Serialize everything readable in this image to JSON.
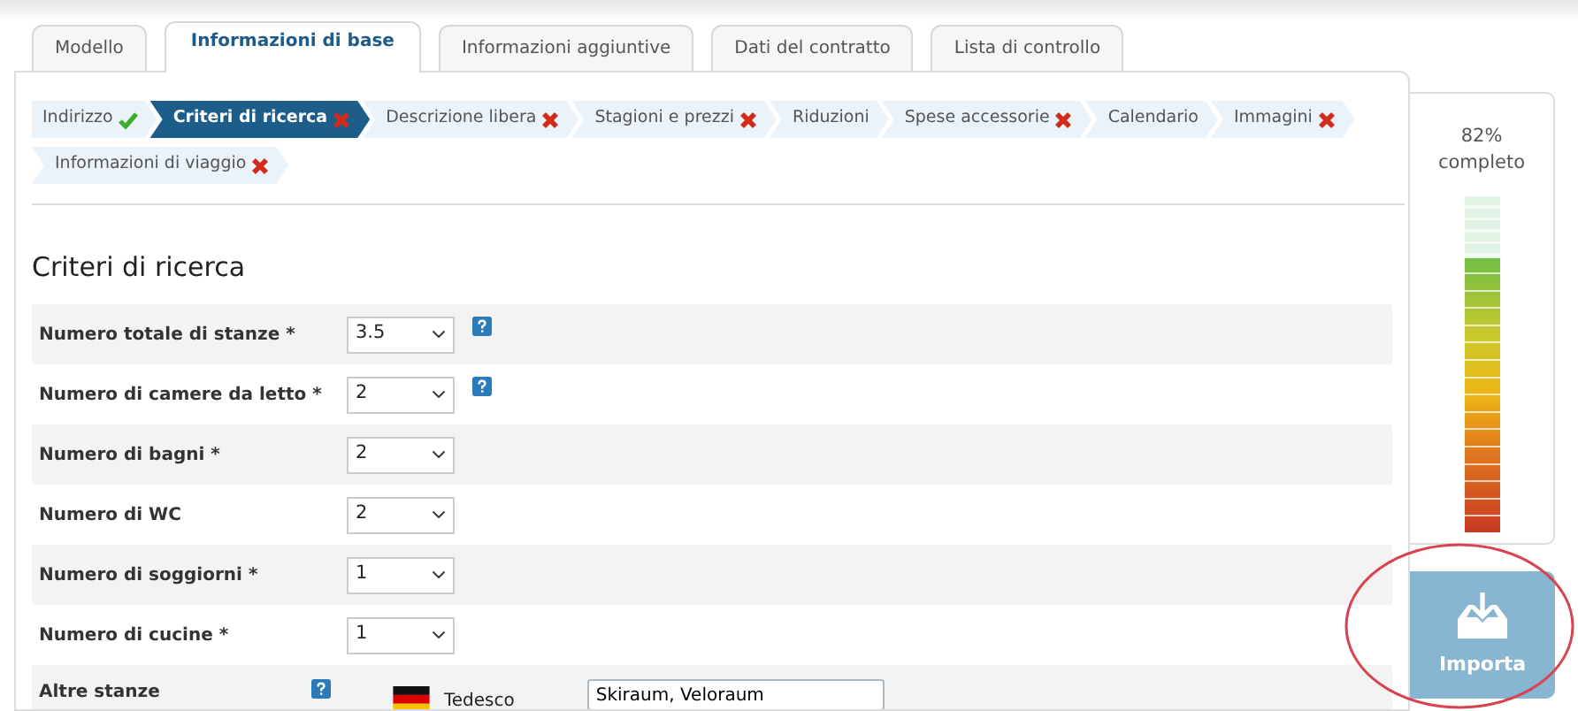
{
  "tabs": [
    {
      "label": "Modello",
      "selected": false
    },
    {
      "label": "Informazioni di base",
      "selected": true
    },
    {
      "label": "Informazioni aggiuntive",
      "selected": false
    },
    {
      "label": "Dati del contratto",
      "selected": false
    },
    {
      "label": "Lista di controllo",
      "selected": false
    }
  ],
  "steps": [
    {
      "label": "Indirizzo",
      "complete": true,
      "invalid": false,
      "selected": false
    },
    {
      "label": "Criteri di ricerca",
      "complete": false,
      "invalid": true,
      "selected": true
    },
    {
      "label": "Descrizione libera",
      "complete": false,
      "invalid": true,
      "selected": false
    },
    {
      "label": "Stagioni e prezzi",
      "complete": false,
      "invalid": true,
      "selected": false
    },
    {
      "label": "Riduzioni",
      "complete": false,
      "invalid": false,
      "selected": false
    },
    {
      "label": "Spese accessorie",
      "complete": false,
      "invalid": true,
      "selected": false
    },
    {
      "label": "Calendario",
      "complete": false,
      "invalid": false,
      "selected": false
    },
    {
      "label": "Immagini",
      "complete": false,
      "invalid": true,
      "selected": false
    },
    {
      "label": "Informazioni di viaggio",
      "complete": false,
      "invalid": true,
      "selected": false
    }
  ],
  "section_title": "Criteri di ricerca",
  "fields": [
    {
      "kind": "select",
      "label": "Numero totale di stanze *",
      "value": "3.5",
      "help": true
    },
    {
      "kind": "select",
      "label": "Numero di camere da letto *",
      "value": "2",
      "help": true
    },
    {
      "kind": "select",
      "label": "Numero di bagni *",
      "value": "2",
      "help": false
    },
    {
      "kind": "select",
      "label": "Numero di WC",
      "value": "2",
      "help": false
    },
    {
      "kind": "select",
      "label": "Numero di soggiorni *",
      "value": "1",
      "help": false
    },
    {
      "kind": "select",
      "label": "Numero di cucine *",
      "value": "1",
      "help": false
    },
    {
      "kind": "translation",
      "label": "Altre stanze",
      "help": true,
      "language": "Tedesco",
      "value": "Skiraum, Veloraum"
    }
  ],
  "progress": {
    "percent": "82%",
    "label": "completo",
    "level": 0.82
  },
  "import_button": {
    "label": "Importa",
    "highlighted": true
  }
}
